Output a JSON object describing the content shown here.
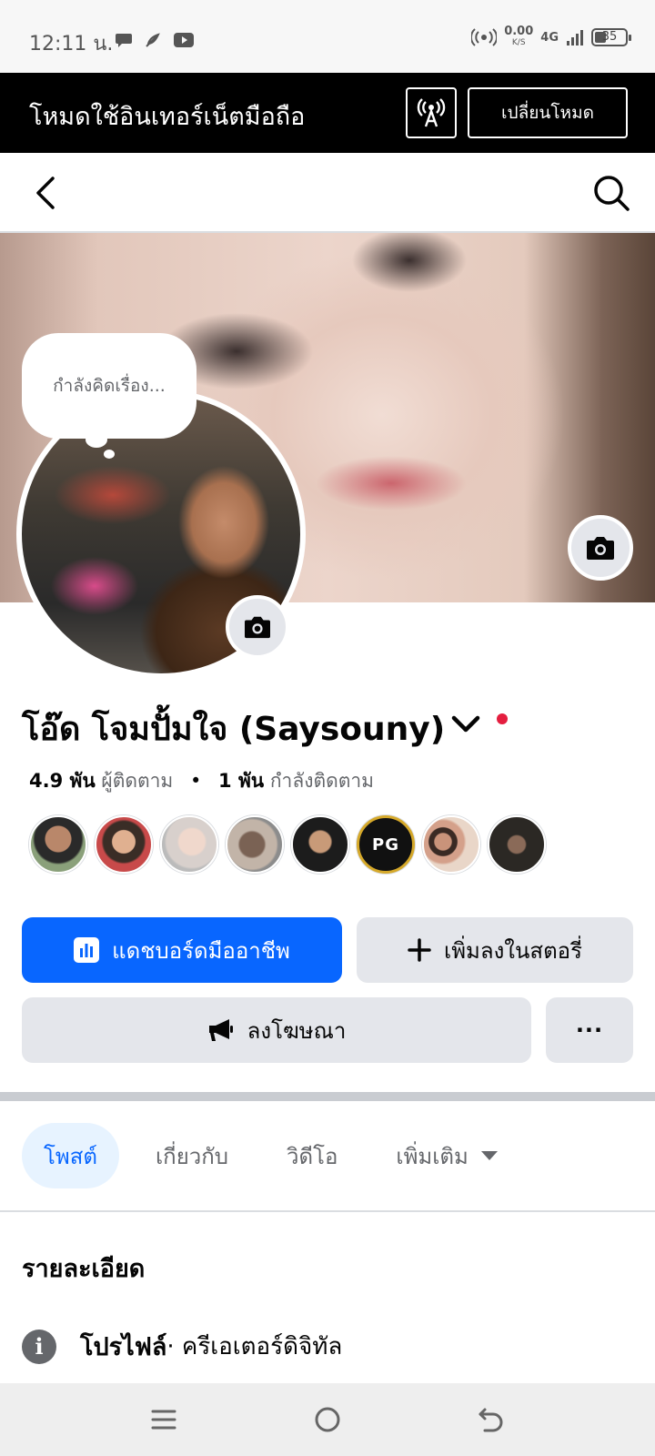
{
  "status_bar": {
    "time": "12:11 น.",
    "net_speed": "0.00",
    "net_speed_unit": "K/S",
    "network": "4G",
    "battery": "35"
  },
  "mode_banner": {
    "text": "โหมดใช้อินเทอร์เน็ตมือถือ",
    "switch_label": "เปลี่ยนโหมด"
  },
  "profile": {
    "thought_placeholder": "กำลังคิดเรื่อง...",
    "name": "โอ๊ด โจมปั้มใจ (Saysouny)",
    "followers_count": "4.9 พัน",
    "followers_label": "ผู้ติดตาม",
    "separator": "•",
    "following_count": "1 พัน",
    "following_label": "กำลังติดตาม",
    "pg_avatar_text": "PG"
  },
  "actions": {
    "dashboard_label": "แดชบอร์ดมืออาชีพ",
    "add_story_label": "เพิ่มลงในสตอรี่",
    "advertise_label": "ลงโฆษณา",
    "more_label": "···"
  },
  "tabs": [
    {
      "label": "โพสต์"
    },
    {
      "label": "เกี่ยวกับ"
    },
    {
      "label": "วิดีโอ"
    },
    {
      "label": "เพิ่มเติม"
    }
  ],
  "details": {
    "title": "รายละเอียด",
    "info_icon_letter": "i",
    "profile_label": "โปรไฟล์",
    "profile_value": " · ครีเอเตอร์ดิจิทัล"
  },
  "colors": {
    "primary": "#0866ff",
    "secondary_button": "#e4e6eb",
    "active_tab_bg": "#e7f3ff",
    "notification_dot": "#e41e3f"
  }
}
